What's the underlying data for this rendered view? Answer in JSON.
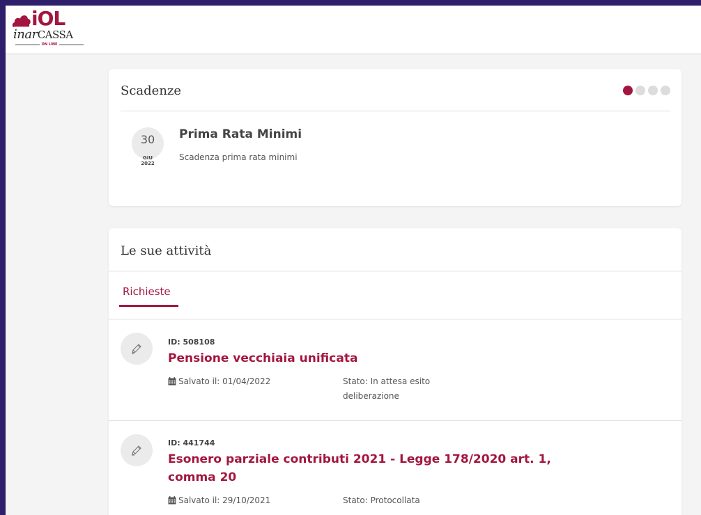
{
  "brand": {
    "iol": "iOL",
    "name_italic": "inar",
    "name_upper": "CASSA",
    "tagline": "ON LINE",
    "accent_color": "#a3163f"
  },
  "scadenze": {
    "title": "Scadenze",
    "carousel_total": 4,
    "carousel_active": 1,
    "item": {
      "day": "30",
      "month": "GIU",
      "year": "2022",
      "title": "Prima Rata Minimi",
      "description": "Scadenza prima rata minimi"
    }
  },
  "attivita": {
    "title": "Le sue attività",
    "tabs": [
      {
        "label": "Richieste",
        "active": true
      }
    ],
    "requests": [
      {
        "id": "ID: 508108",
        "title": "Pensione vecchiaia unificata",
        "saved": "Salvato il: 01/04/2022",
        "status": "Stato: In attesa esito deliberazione",
        "icon": "pencil-icon"
      },
      {
        "id": "ID: 441744",
        "title": "Esonero parziale contributi 2021 - Legge 178/2020 art. 1, comma 20",
        "saved": "Salvato il: 29/10/2021",
        "status": "Stato: Protocollata",
        "icon": "pencil-icon"
      }
    ]
  }
}
